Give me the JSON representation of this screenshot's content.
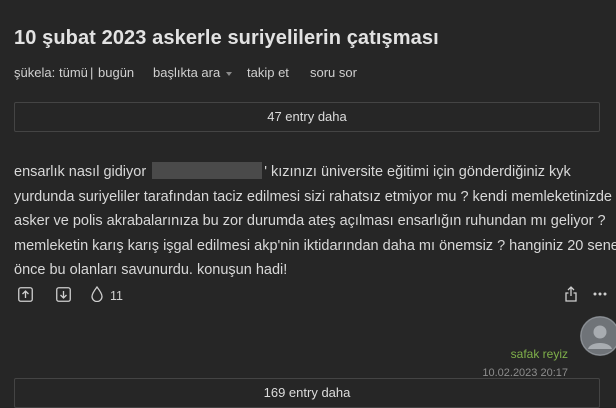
{
  "topic": {
    "title": "10 şubat 2023 askerle suriyelilerin çatışması"
  },
  "subnav": {
    "sukela_label": "şükela:",
    "tumu": "tümü",
    "separator": "|",
    "bugun": "bugün",
    "search_in_title": "başlıkta ara",
    "follow": "takip et",
    "ask": "soru sor"
  },
  "more_entries_top": "47 entry daha",
  "entry": {
    "lines": [
      "ensarlık nasıl gidiyor",
      "' kızınızı üniversite eğitimi için gönderdiğiniz kyk",
      "yurdunda suriyeliler tarafından taciz edilmesi sizi rahatsız etmiyor mu ? kendi memleketinizde",
      "asker ve polis akrabalarınıza bu zor durumda ateş açılması ensarlığın ruhundan mı geliyor ?",
      "memleketin karış karış işgal edilmesi akp'nin iktidarından daha mı önemsiz ? hanginiz 20 sene",
      "önce bu olanları savunurdu. konuşun hadi!"
    ],
    "favorite_count": "11",
    "author": "safak reyiz",
    "date": "10.02.2023 20:17"
  },
  "more_entries_bottom": "169 entry daha",
  "colors": {
    "background": "#262626",
    "author": "#7fb04a",
    "border": "#444444"
  },
  "icons": [
    "upvote-icon",
    "downvote-icon",
    "favorite-drop-icon",
    "share-icon",
    "more-dots-icon",
    "avatar"
  ]
}
